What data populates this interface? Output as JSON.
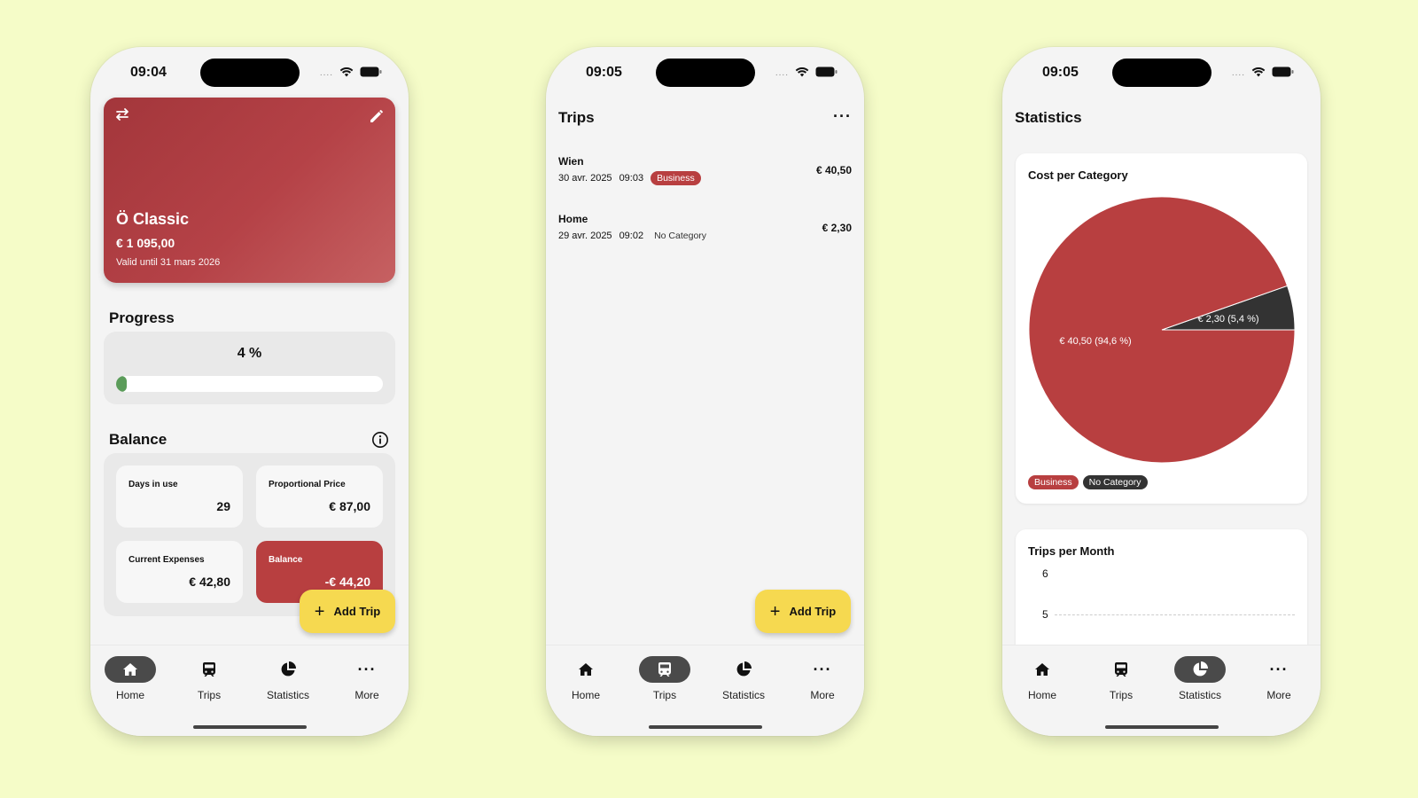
{
  "status": {
    "time_1": "09:04",
    "time_2": "09:05",
    "time_3": "09:05"
  },
  "nav": {
    "home": "Home",
    "trips": "Trips",
    "statistics": "Statistics",
    "more": "More"
  },
  "fab_label": "Add Trip",
  "home": {
    "ticket": {
      "name": "Ö Classic",
      "price": "€ 1 095,00",
      "valid": "Valid until 31 mars 2026"
    },
    "progress_title": "Progress",
    "progress_label": "4 %",
    "progress_value": 0.04,
    "balance_title": "Balance",
    "stats": {
      "days_label": "Days in use",
      "days_value": "29",
      "prop_label": "Proportional Price",
      "prop_value": "€ 87,00",
      "expenses_label": "Current Expenses",
      "expenses_value": "€ 42,80",
      "balance_label": "Balance",
      "balance_value": "-€ 44,20"
    }
  },
  "trips": {
    "title": "Trips",
    "items": [
      {
        "name": "Wien",
        "date": "30 avr. 2025",
        "time": "09:03",
        "category": "Business",
        "cost": "€ 40,50"
      },
      {
        "name": "Home",
        "date": "29 avr. 2025",
        "time": "09:02",
        "category": "No Category",
        "cost": "€ 2,30"
      }
    ]
  },
  "statistics": {
    "title": "Statistics",
    "cost_card_title": "Cost per Category",
    "trips_card_title": "Trips per Month",
    "legend": [
      {
        "label": "Business",
        "color": "#b83f40"
      },
      {
        "label": "No Category",
        "color": "#333333"
      }
    ]
  },
  "chart_data": [
    {
      "type": "pie",
      "title": "Cost per Category",
      "categories": [
        "Business",
        "No Category"
      ],
      "values": [
        40.5,
        2.3
      ],
      "labels": [
        "€ 40,50 (94,6 %)",
        "€ 2,30 (5,4 %)"
      ],
      "colors": [
        "#b83f40",
        "#333333"
      ],
      "legend": "bottom-left"
    },
    {
      "type": "line",
      "title": "Trips per Month",
      "y_ticks": [
        "6",
        "5"
      ],
      "grid": true
    }
  ],
  "colors": {
    "accent_red": "#b83f40",
    "fab_yellow": "#f6d950",
    "progress_green": "#5b9c5a",
    "background": "#f5fcc8"
  }
}
